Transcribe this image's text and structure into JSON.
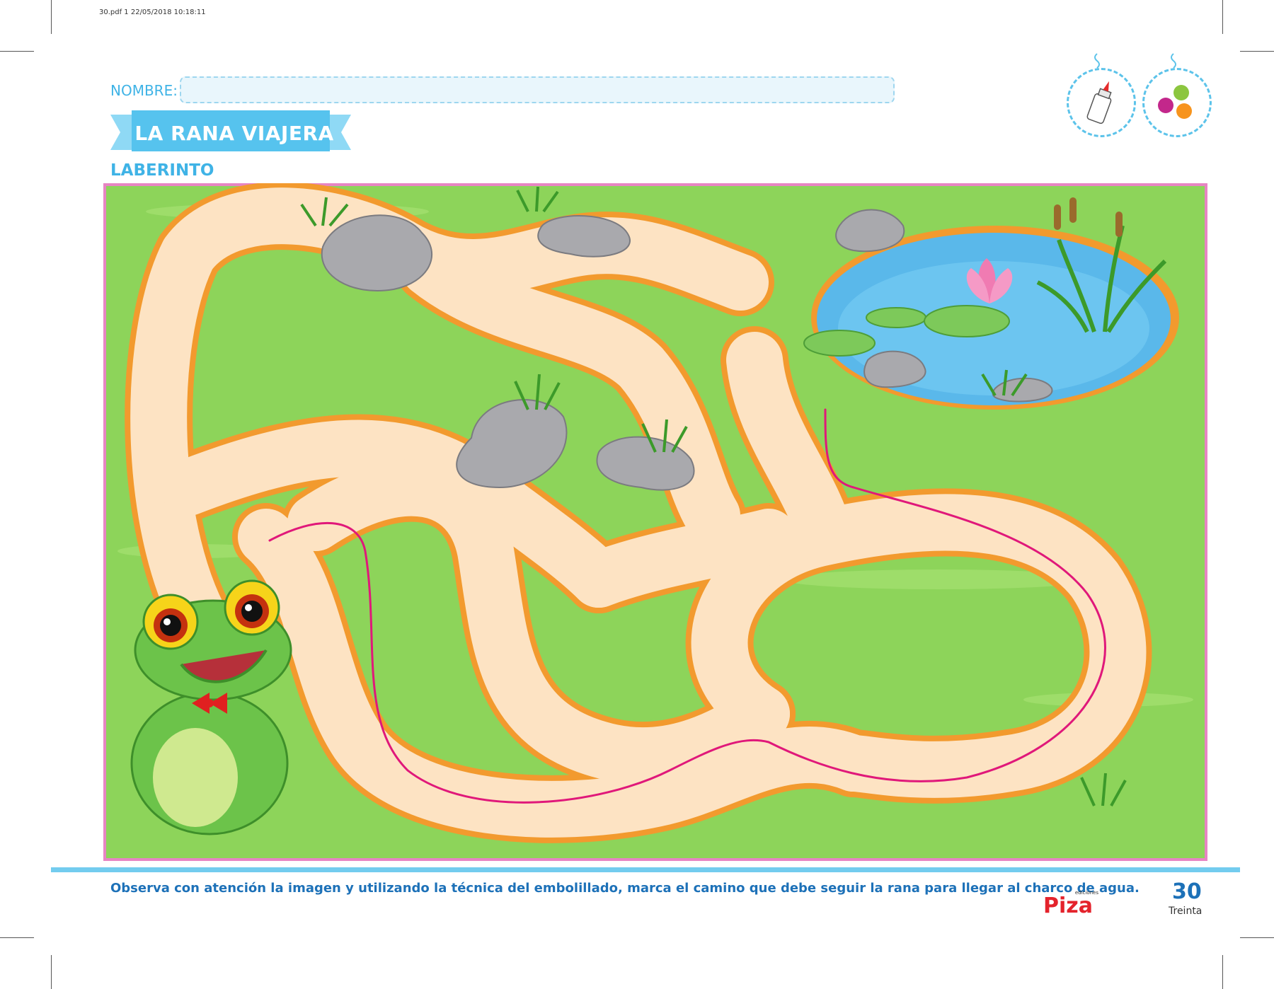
{
  "print_meta": "30.pdf   1   22/05/2018   10:18:11",
  "header": {
    "name_label": "NOMBRE:",
    "title": "LA RANA VIAJERA",
    "subtitle": "LABERINTO"
  },
  "materials": [
    {
      "icon": "glue-bottle-icon"
    },
    {
      "icon": "tissue-paper-balls-icon"
    }
  ],
  "scene": {
    "character": "frog-icon",
    "goal": "pond-icon",
    "colors": {
      "grass": "#8dd45a",
      "path": "#fde3c3",
      "path_border": "#f29a2e",
      "guide_line": "#e0187a",
      "frame": "#e785c3",
      "water": "#5ab8ea"
    }
  },
  "footer": {
    "instructions": "Observa con atención la imagen y utilizando la técnica del embolillado, marca el camino que debe seguir la rana para llegar al charco de agua.",
    "logo_small": "ediciones",
    "logo_text": "Piza",
    "page_number": "30",
    "page_word": "Treinta"
  }
}
